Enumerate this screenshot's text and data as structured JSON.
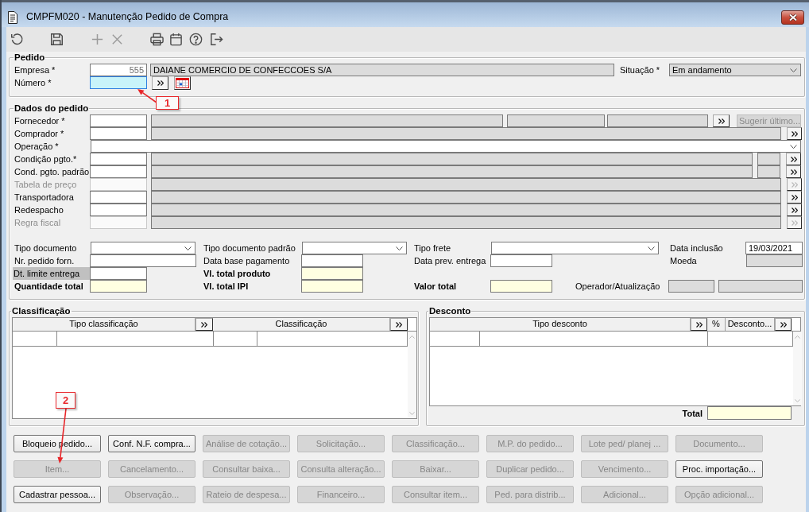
{
  "window": {
    "title": "CMPFM020 - Manutenção Pedido de Compra"
  },
  "toolbar": [
    {
      "kind": "undo",
      "disabled": false
    },
    {
      "kind": "save",
      "disabled": false
    },
    {
      "kind": "add",
      "disabled": true
    },
    {
      "kind": "delete",
      "disabled": true
    },
    {
      "kind": "print",
      "disabled": false
    },
    {
      "kind": "calendar",
      "disabled": false
    },
    {
      "kind": "help",
      "disabled": false
    },
    {
      "kind": "exit",
      "disabled": false
    }
  ],
  "pedido": {
    "title": "Pedido",
    "empresa": {
      "label": "Empresa *",
      "code": "555",
      "name": "DAIANE COMERCIO DE CONFECCOES S/A"
    },
    "situacao": {
      "label": "Situação *",
      "value": "Em andamento"
    },
    "numero": {
      "label": "Número *",
      "focused": true
    }
  },
  "dados": {
    "title": "Dados do pedido",
    "rows": [
      {
        "label": "Fornecedor *",
        "kind": "supplier",
        "disabled": false,
        "button": {
          "label": "Sugerir último...",
          "disabled": true
        }
      },
      {
        "label": "Comprador *",
        "kind": "lookup",
        "disabled": false
      },
      {
        "label": "Operação *",
        "kind": "select",
        "disabled": false
      },
      {
        "label": "Condição pgto.*",
        "kind": "lookup_extra",
        "disabled": false
      },
      {
        "label": "Cond. pgto. padrão",
        "kind": "lookup_extra",
        "disabled": false
      },
      {
        "label": "Tabela de preço",
        "kind": "lookup",
        "disabled": true
      },
      {
        "label": "Transportadora",
        "kind": "lookup",
        "disabled": false
      },
      {
        "label": "Redespacho",
        "kind": "lookup",
        "disabled": false
      },
      {
        "label": "Regra fiscal",
        "kind": "lookup",
        "disabled": true
      }
    ],
    "fields": [
      [
        {
          "label": "Tipo documento",
          "kind": "select",
          "highlighted": false
        },
        {
          "label": "Tipo documento padrão",
          "kind": "select",
          "highlighted": false
        },
        {
          "label": "Tipo frete",
          "kind": "select",
          "highlighted": false
        },
        {
          "label": "Data inclusão",
          "kind": "input",
          "value": "19/03/2021",
          "highlighted": false
        }
      ],
      [
        {
          "label": "Nr. pedido forn.",
          "kind": "input",
          "highlighted": false
        },
        {
          "label": "Data base pagamento",
          "kind": "input",
          "highlighted": false
        },
        {
          "label": "Data prev. entrega",
          "kind": "input",
          "highlighted": false
        },
        {
          "label": "Moeda",
          "kind": "readonly",
          "highlighted": false
        }
      ],
      [
        {
          "label": "Dt. limite entrega",
          "kind": "input",
          "highlighted": true
        },
        {
          "label": "Vl. total produto",
          "kind": "total",
          "highlighted": false
        }
      ],
      [
        {
          "label": "Quantidade total",
          "kind": "total",
          "highlighted": false
        },
        {
          "label": "Vl. total IPI",
          "kind": "total",
          "highlighted": false
        },
        {
          "label": "Valor total",
          "kind": "total",
          "highlighted": false
        },
        {
          "label": "Operador/Atualização",
          "kind": "readonly_pair",
          "highlighted": false
        }
      ]
    ]
  },
  "classificacao": {
    "title": "Classificação",
    "columns": [
      {
        "label": "Tipo classificação",
        "lookup": true
      },
      {
        "label": "Classificação",
        "lookup": true
      }
    ]
  },
  "desconto": {
    "title": "Desconto",
    "columns": [
      {
        "label": "Tipo desconto",
        "lookup": true
      },
      {
        "label": "%",
        "lookup": false
      },
      {
        "label": "Desconto...",
        "lookup": true
      }
    ],
    "total_label": "Total"
  },
  "actions": [
    {
      "label": "Bloqueio pedido...",
      "disabled": false
    },
    {
      "label": "Conf. N.F. compra...",
      "disabled": false
    },
    {
      "label": "Análise de cotação...",
      "disabled": true
    },
    {
      "label": "Solicitação...",
      "disabled": true
    },
    {
      "label": "Classificação...",
      "disabled": true
    },
    {
      "label": "M.P. do pedido...",
      "disabled": true
    },
    {
      "label": "Lote ped/ planej ...",
      "disabled": true
    },
    {
      "label": "Documento...",
      "disabled": true
    },
    {
      "label": "Item...",
      "disabled": true
    },
    {
      "label": "Cancelamento...",
      "disabled": true
    },
    {
      "label": "Consultar baixa...",
      "disabled": true
    },
    {
      "label": "Consulta alteração...",
      "disabled": true
    },
    {
      "label": "Baixar...",
      "disabled": true
    },
    {
      "label": "Duplicar pedido...",
      "disabled": true
    },
    {
      "label": "Vencimento...",
      "disabled": true
    },
    {
      "label": "Proc. importação...",
      "disabled": false
    },
    {
      "label": "Cadastrar pessoa...",
      "disabled": false
    },
    {
      "label": "Observação...",
      "disabled": true
    },
    {
      "label": "Rateio de despesa...",
      "disabled": true
    },
    {
      "label": "Financeiro...",
      "disabled": true
    },
    {
      "label": "Consultar item...",
      "disabled": true
    },
    {
      "label": "Ped. para distrib...",
      "disabled": true
    },
    {
      "label": "Adicional...",
      "disabled": true
    },
    {
      "label": "Opção adicional...",
      "disabled": true
    }
  ],
  "annotations": [
    {
      "label": "1"
    },
    {
      "label": "2"
    }
  ]
}
